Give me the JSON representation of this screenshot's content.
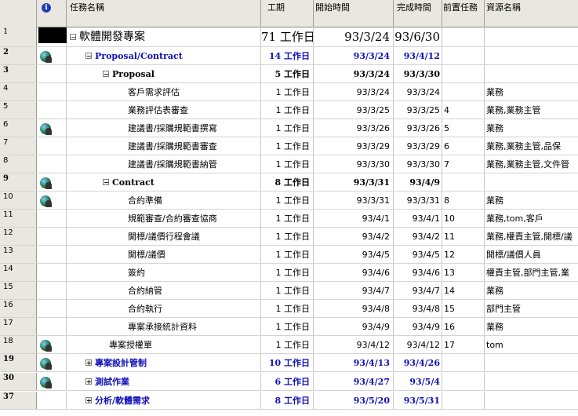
{
  "header": {
    "name": "任務名稱",
    "duration": "工期",
    "start": "開始時間",
    "finish": "完成時間",
    "predecessors": "前置任務",
    "resources": "資源名稱",
    "info": "i"
  },
  "rows": [
    {
      "id": "1",
      "name": "軟體開發專案",
      "duration": "71 工作日",
      "start": "93/3/24",
      "finish": "93/6/30",
      "pred": "",
      "res": ""
    },
    {
      "id": "2",
      "name": "Proposal/Contract",
      "duration": "14 工作日",
      "start": "93/3/24",
      "finish": "93/4/12",
      "pred": "",
      "res": ""
    },
    {
      "id": "3",
      "name": "Proposal",
      "duration": "5 工作日",
      "start": "93/3/24",
      "finish": "93/3/30",
      "pred": "",
      "res": ""
    },
    {
      "id": "4",
      "name": "客戶需求評估",
      "duration": "1 工作日",
      "start": "93/3/24",
      "finish": "93/3/24",
      "pred": "",
      "res": "業務"
    },
    {
      "id": "5",
      "name": "業務評估表審查",
      "duration": "1 工作日",
      "start": "93/3/25",
      "finish": "93/3/25",
      "pred": "4",
      "res": "業務,業務主管"
    },
    {
      "id": "6",
      "name": "建議書/採購規範書撰寫",
      "duration": "1 工作日",
      "start": "93/3/26",
      "finish": "93/3/26",
      "pred": "5",
      "res": "業務"
    },
    {
      "id": "7",
      "name": "建議書/採購規範書審查",
      "duration": "1 工作日",
      "start": "93/3/29",
      "finish": "93/3/29",
      "pred": "6",
      "res": "業務,業務主管,品保"
    },
    {
      "id": "8",
      "name": "建議書/採購規範書納管",
      "duration": "1 工作日",
      "start": "93/3/30",
      "finish": "93/3/30",
      "pred": "7",
      "res": "業務,業務主管,文件管"
    },
    {
      "id": "9",
      "name": "Contract",
      "duration": "8 工作日",
      "start": "93/3/31",
      "finish": "93/4/9",
      "pred": "",
      "res": ""
    },
    {
      "id": "10",
      "name": "合約準備",
      "duration": "1 工作日",
      "start": "93/3/31",
      "finish": "93/3/31",
      "pred": "8",
      "res": "業務"
    },
    {
      "id": "11",
      "name": "規範審查/合約審查協商",
      "duration": "1 工作日",
      "start": "93/4/1",
      "finish": "93/4/1",
      "pred": "10",
      "res": "業務,tom,客戶"
    },
    {
      "id": "12",
      "name": "開標/議價行程會議",
      "duration": "1 工作日",
      "start": "93/4/2",
      "finish": "93/4/2",
      "pred": "11",
      "res": "業務,權責主管,開標/議"
    },
    {
      "id": "13",
      "name": "開標/議價",
      "duration": "1 工作日",
      "start": "93/4/5",
      "finish": "93/4/5",
      "pred": "12",
      "res": "開標/議價人員"
    },
    {
      "id": "14",
      "name": "簽約",
      "duration": "1 工作日",
      "start": "93/4/6",
      "finish": "93/4/6",
      "pred": "13",
      "res": "權責主管,部門主管,業"
    },
    {
      "id": "15",
      "name": "合約納管",
      "duration": "1 工作日",
      "start": "93/4/7",
      "finish": "93/4/7",
      "pred": "14",
      "res": "業務"
    },
    {
      "id": "16",
      "name": "合約執行",
      "duration": "1 工作日",
      "start": "93/4/8",
      "finish": "93/4/8",
      "pred": "15",
      "res": "部門主管"
    },
    {
      "id": "17",
      "name": "專案承接統計資料",
      "duration": "1 工作日",
      "start": "93/4/9",
      "finish": "93/4/9",
      "pred": "16",
      "res": "業務"
    },
    {
      "id": "18",
      "name": "專案授權單",
      "duration": "1 工作日",
      "start": "93/4/12",
      "finish": "93/4/12",
      "pred": "17",
      "res": "tom"
    },
    {
      "id": "19",
      "name": "專案設計管制",
      "duration": "10 工作日",
      "start": "93/4/13",
      "finish": "93/4/26",
      "pred": "",
      "res": ""
    },
    {
      "id": "30",
      "name": "測試作業",
      "duration": "6 工作日",
      "start": "93/4/27",
      "finish": "93/5/4",
      "pred": "",
      "res": ""
    },
    {
      "id": "37",
      "name": "分析/軟體需求",
      "duration": "8 工作日",
      "start": "93/5/20",
      "finish": "93/5/31",
      "pred": "",
      "res": ""
    }
  ]
}
